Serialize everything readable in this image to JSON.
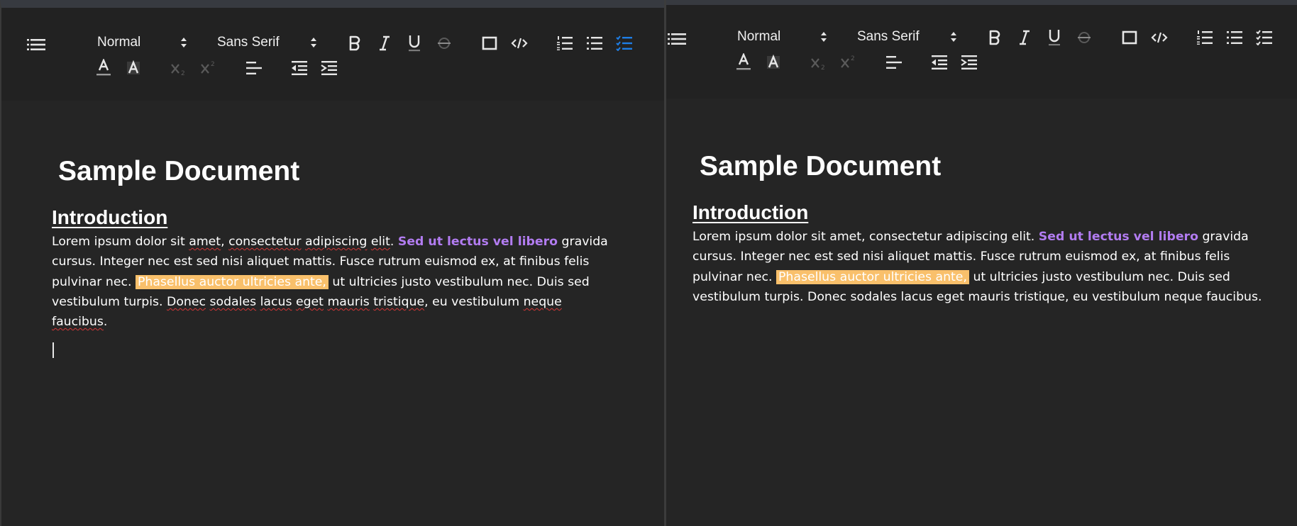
{
  "toolbar": {
    "paragraph_style": "Normal",
    "font_family": "Sans Serif",
    "buttons": [
      {
        "name": "outline-toggle",
        "icon": "list-outline-icon"
      },
      {
        "name": "bold",
        "icon": "bold-icon"
      },
      {
        "name": "italic",
        "icon": "italic-icon"
      },
      {
        "name": "underline",
        "icon": "underline-icon"
      },
      {
        "name": "strikethrough",
        "icon": "strikethrough-icon",
        "disabled": true
      },
      {
        "name": "box",
        "icon": "square-icon"
      },
      {
        "name": "code",
        "icon": "code-icon"
      },
      {
        "name": "ordered-list",
        "icon": "ordered-list-icon"
      },
      {
        "name": "bullet-list",
        "icon": "bullet-list-icon"
      },
      {
        "name": "check-list",
        "icon": "check-list-icon"
      },
      {
        "name": "text-color",
        "icon": "text-color-icon"
      },
      {
        "name": "highlight-color",
        "icon": "highlight-icon"
      },
      {
        "name": "subscript",
        "icon": "subscript-icon",
        "disabled": true
      },
      {
        "name": "superscript",
        "icon": "superscript-icon",
        "disabled": true
      },
      {
        "name": "align",
        "icon": "align-left-icon"
      },
      {
        "name": "outdent",
        "icon": "outdent-icon"
      },
      {
        "name": "indent",
        "icon": "indent-icon"
      }
    ],
    "left_active_button": "check-list"
  },
  "colors": {
    "accent": "#1e7ee6",
    "link_purple": "#b27cf1",
    "highlight": "#f9c06b",
    "spellcheck": "#d23737"
  },
  "document": {
    "title": "Sample Document",
    "heading": "Introduction",
    "text_part1": "Lorem ipsum dolor sit amet, consectetur adipiscing elit.",
    "purple_text": "Sed ut lectus vel libero",
    "text_part2": "gravida cursus. Integer nec est sed nisi aliquet mattis. Fusce rutrum euismod ex, at finibus felis pulvinar nec.",
    "highlight_text": "Phasellus auctor ultricies ante,",
    "text_part3": "ut ultricies justo vestibulum nec. Duis sed vestibulum turpis. Donec sodales lacus eget mauris tristique, eu vestibulum neque faucibus.",
    "misspelled_words": [
      "amet",
      "consectetur",
      "adipiscing",
      "elit",
      "Donec",
      "sodales",
      "lacus",
      "eget",
      "mauris",
      "tristique",
      "neque",
      "faucibus"
    ]
  }
}
